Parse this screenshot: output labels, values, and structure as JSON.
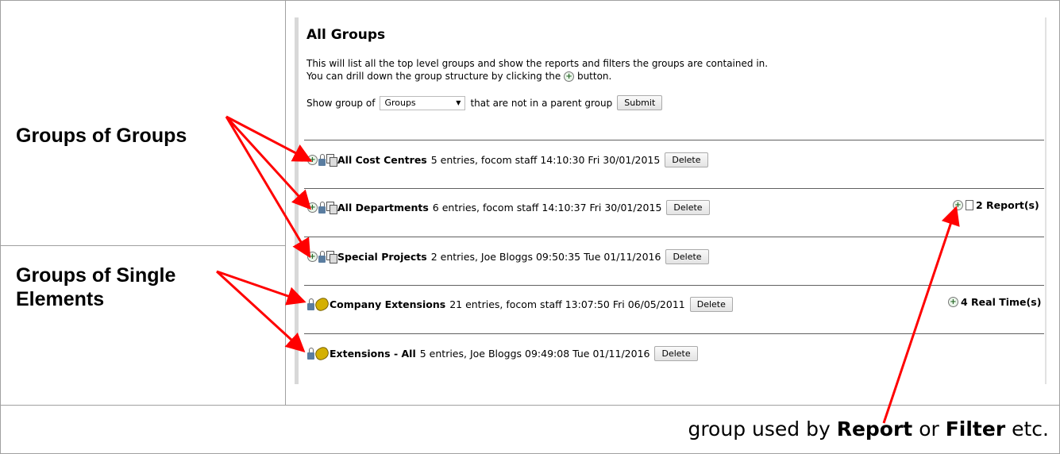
{
  "annotations": {
    "groups_of_groups": "Groups of Groups",
    "groups_of_single_line1": "Groups of Single",
    "groups_of_single_line2": "Elements",
    "caption_pre": "group used by ",
    "caption_report": "Report",
    "caption_mid": " or ",
    "caption_filter": "Filter",
    "caption_post": " etc."
  },
  "page": {
    "title": "All Groups",
    "description_line1": "This will list all the top level groups and show the reports and filters the groups are contained in.",
    "description_line2_pre": "You can drill down the group structure by clicking the",
    "description_line2_post": "button.",
    "show_label": "Show group of",
    "select_value": "Groups",
    "show_suffix": "that are not in a parent group",
    "submit_label": "Submit"
  },
  "groups": [
    {
      "name": "All Cost Centres",
      "meta": "5 entries, focom staff 14:10:30 Fri 30/01/2015",
      "delete": "Delete",
      "kind": "group-of-groups",
      "side": ""
    },
    {
      "name": "All Departments",
      "meta": "6 entries, focom staff 14:10:37 Fri 30/01/2015",
      "delete": "Delete",
      "kind": "group-of-groups",
      "side": "2 Report(s)"
    },
    {
      "name": "Special Projects",
      "meta": "2 entries, Joe Bloggs 09:50:35 Tue 01/11/2016",
      "delete": "Delete",
      "kind": "group-of-groups",
      "side": ""
    },
    {
      "name": "Company Extensions",
      "meta": "21 entries, focom staff 13:07:50 Fri 06/05/2011",
      "delete": "Delete",
      "kind": "group-of-elements",
      "side": "4 Real Time(s)"
    },
    {
      "name": "Extensions - All",
      "meta": "5 entries, Joe Bloggs 09:49:08 Tue 01/11/2016",
      "delete": "Delete",
      "kind": "group-of-elements",
      "side": ""
    }
  ],
  "colors": {
    "arrow": "#ff0000",
    "expand_icon": "#2a6a2a"
  }
}
